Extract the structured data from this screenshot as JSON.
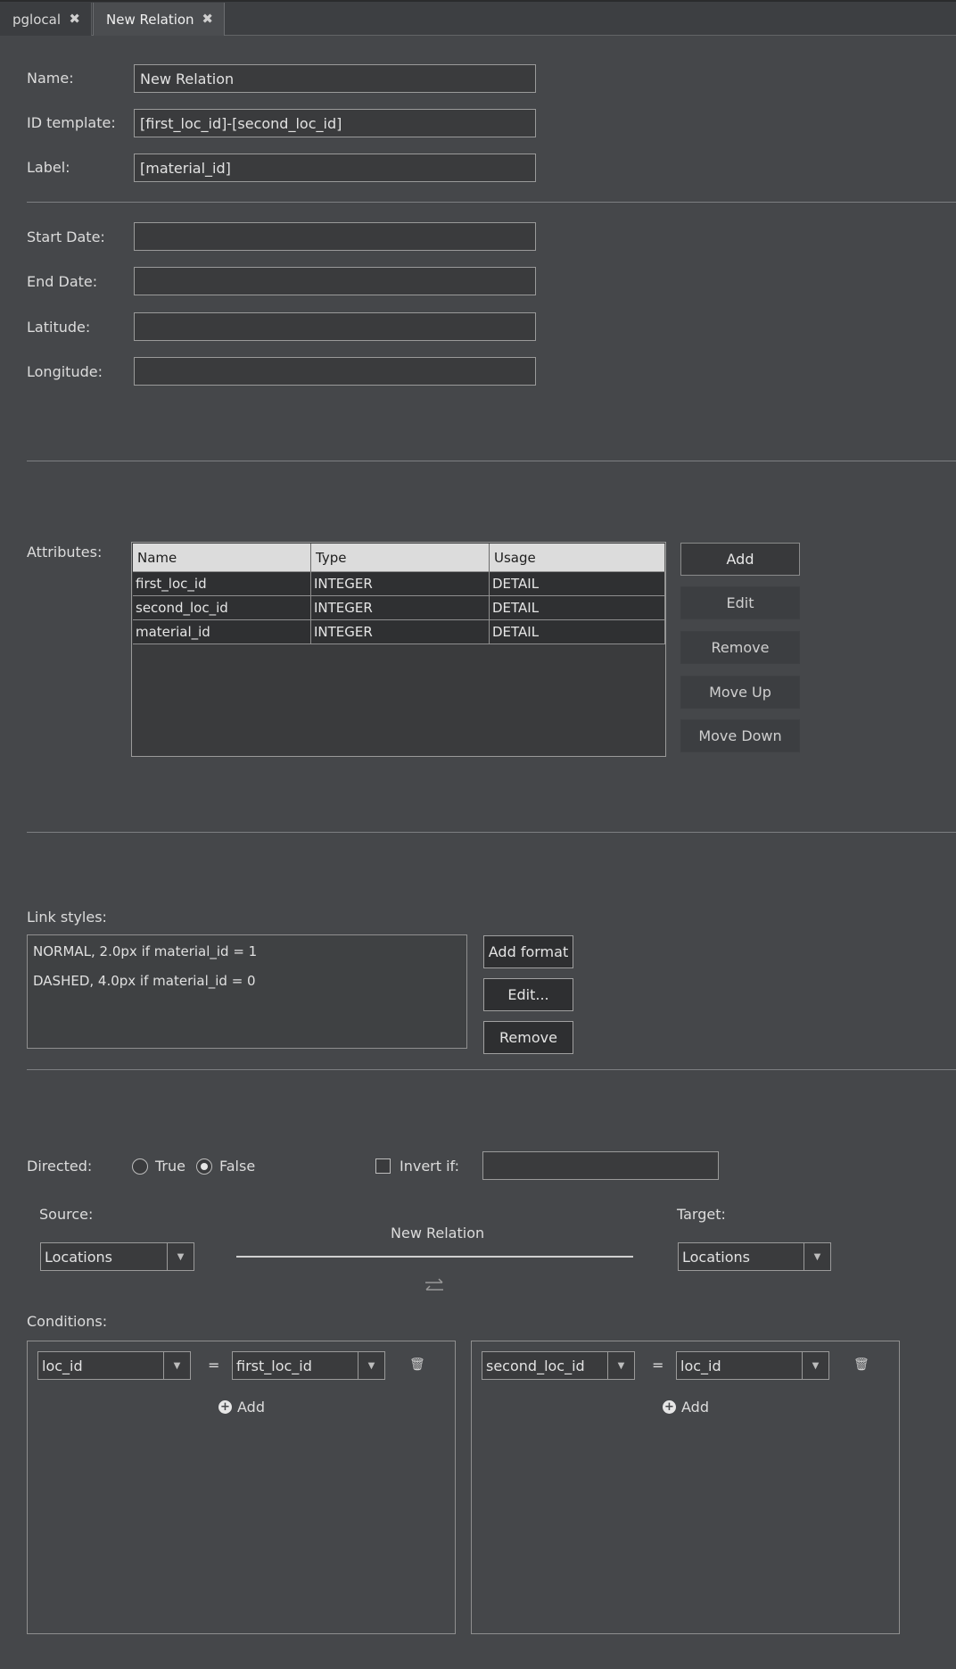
{
  "tabs": [
    {
      "label": "pglocal",
      "close_icon": "close-icon"
    },
    {
      "label": "New Relation",
      "close_icon": "close-icon",
      "active": true
    }
  ],
  "form": {
    "name_label": "Name:",
    "name_value": "New Relation",
    "id_template_label": "ID template:",
    "id_template_value": "[first_loc_id]-[second_loc_id]",
    "label_label": "Label:",
    "label_value": "[material_id]",
    "start_date_label": "Start Date:",
    "start_date_value": "",
    "end_date_label": "End Date:",
    "end_date_value": "",
    "latitude_label": "Latitude:",
    "latitude_value": "",
    "longitude_label": "Longitude:",
    "longitude_value": ""
  },
  "attributes": {
    "label": "Attributes:",
    "columns": [
      "Name",
      "Type",
      "Usage"
    ],
    "rows": [
      [
        "first_loc_id",
        "INTEGER",
        "DETAIL"
      ],
      [
        "second_loc_id",
        "INTEGER",
        "DETAIL"
      ],
      [
        "material_id",
        "INTEGER",
        "DETAIL"
      ]
    ],
    "buttons": {
      "add": "Add",
      "edit": "Edit",
      "remove": "Remove",
      "move_up": "Move Up",
      "move_down": "Move Down"
    }
  },
  "link_styles": {
    "label": "Link styles:",
    "items": [
      "NORMAL, 2.0px if material_id = 1",
      "DASHED, 4.0px if material_id = 0"
    ],
    "buttons": {
      "add_format": "Add format",
      "edit": "Edit...",
      "remove": "Remove"
    }
  },
  "directed": {
    "label": "Directed:",
    "true_label": "True",
    "false_label": "False",
    "selected": "False",
    "invert_if_label": "Invert if:",
    "invert_if_checked": false,
    "invert_if_value": ""
  },
  "relation": {
    "source_label": "Source:",
    "source_value": "Locations",
    "target_label": "Target:",
    "target_value": "Locations",
    "center_label": "New Relation",
    "swap_icon": "swap-arrows-icon"
  },
  "conditions": {
    "label": "Conditions:",
    "left": {
      "field": "loc_id",
      "operator": "=",
      "value": "first_loc_id",
      "add_label": "Add"
    },
    "right": {
      "field": "second_loc_id",
      "operator": "=",
      "value": "loc_id",
      "add_label": "Add"
    }
  }
}
